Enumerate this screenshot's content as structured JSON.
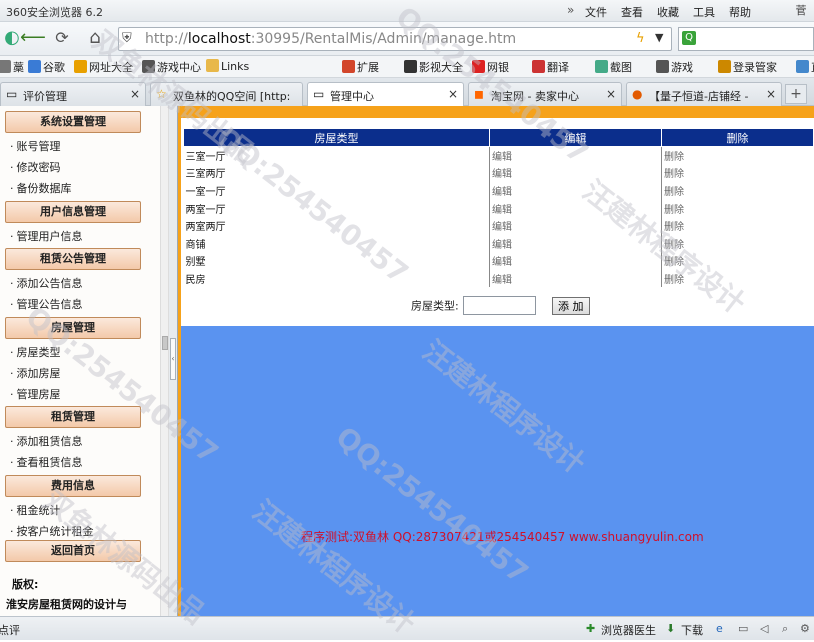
{
  "window": {
    "title": "360安全浏览器 6.2",
    "chevron": "»",
    "menu": [
      "文件",
      "查看",
      "收藏",
      "工具",
      "帮助"
    ],
    "restore": "菅"
  },
  "address": {
    "url_host": "localhost",
    "url_prefix": "http://",
    "url_rest": ":30995/RentalMis/Admin/manage.htm"
  },
  "favorites": [
    {
      "label": "藁",
      "icon": "bookmark-icon",
      "color": "#777"
    },
    {
      "label": "谷歌",
      "icon": "google-icon",
      "color": "#3a7bd5"
    },
    {
      "label": "网址大全",
      "icon": "globe-icon",
      "color": "#e8a000"
    },
    {
      "label": "游戏中心",
      "icon": "gamepad-icon",
      "color": "#555"
    },
    {
      "label": "Links",
      "icon": "folder-icon",
      "color": "#e8b84a"
    },
    {
      "label": "扩展",
      "icon": "grid-icon",
      "color": "#d2462b"
    },
    {
      "label": "影视大全",
      "icon": "play-icon",
      "color": "#333"
    },
    {
      "label": "网银",
      "icon": "bank-icon",
      "color": "#d22"
    },
    {
      "label": "翻译",
      "icon": "translate-icon",
      "color": "#c33"
    },
    {
      "label": "截图",
      "icon": "scissors-icon",
      "color": "#4a8"
    },
    {
      "label": "游戏",
      "icon": "joystick-icon",
      "color": "#555"
    },
    {
      "label": "登录管家",
      "icon": "key-icon",
      "color": "#c80"
    },
    {
      "label": "直",
      "icon": "doc-icon",
      "color": "#48c"
    }
  ],
  "tabs": [
    {
      "label": "评价管理",
      "icon": "page-icon",
      "active": false
    },
    {
      "label": "双鱼林的QQ空间 [http:",
      "icon": "star-icon",
      "active": false
    },
    {
      "label": "管理中心",
      "icon": "page-icon",
      "active": true
    },
    {
      "label": "淘宝网 - 卖家中心",
      "icon": "taobao-icon",
      "active": false
    },
    {
      "label": "【量子恒道-店铺经 -",
      "icon": "firefox-icon",
      "active": false
    }
  ],
  "sidebar": {
    "sections": [
      {
        "title": "系统设置管理",
        "items": [
          "账号管理",
          "修改密码",
          "备份数据库"
        ]
      },
      {
        "title": "用户信息管理",
        "items": [
          "管理用户信息"
        ]
      },
      {
        "title": "租赁公告管理",
        "items": [
          "添加公告信息",
          "管理公告信息"
        ]
      },
      {
        "title": "房屋管理",
        "items": [
          "房屋类型",
          "添加房屋",
          "管理房屋"
        ]
      },
      {
        "title": "租赁管理",
        "items": [
          "添加租赁信息",
          "查看租赁信息"
        ]
      },
      {
        "title": "费用信息",
        "items": [
          "租金统计",
          "按客户统计租金"
        ]
      },
      {
        "title": "返回首页",
        "items": []
      }
    ],
    "copyright_label": "版权:",
    "copyright_text": "淮安房屋租赁网的设计与"
  },
  "table": {
    "headers": [
      "房屋类型",
      "编辑",
      "删除"
    ],
    "rows": [
      [
        "三室一厅",
        "编辑",
        "删除"
      ],
      [
        "三室两厅",
        "编辑",
        "删除"
      ],
      [
        "一室一厅",
        "编辑",
        "删除"
      ],
      [
        "两室一厅",
        "编辑",
        "删除"
      ],
      [
        "两室两厅",
        "编辑",
        "删除"
      ],
      [
        "商铺",
        "编辑",
        "删除"
      ],
      [
        "别墅",
        "编辑",
        "删除"
      ],
      [
        "民房",
        "编辑",
        "删除"
      ]
    ]
  },
  "form": {
    "label": "房屋类型:",
    "value": "",
    "button": "添 加"
  },
  "credit": "程序测试:双鱼林 QQ:287307421或254540457 www.shuangyulin.com",
  "status": {
    "left": "点评",
    "doctor": "浏览器医生",
    "download": "下载"
  },
  "watermarks": [
    "汪建林程序设计",
    "QQ:254540457",
    "双鱼林源码出品"
  ]
}
